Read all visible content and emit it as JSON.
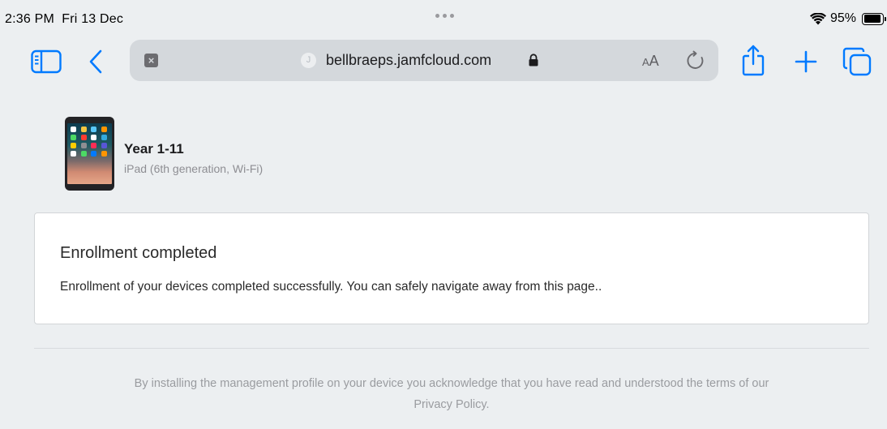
{
  "status_bar": {
    "time": "2:36 PM",
    "date": "Fri 13 Dec",
    "battery": "95%",
    "battery_level": 0.95
  },
  "toolbar": {
    "favicon_letter": "J",
    "url": "bellbraeps.jamfcloud.com",
    "reader_label_small": "A",
    "reader_label_large": "A",
    "accent_color": "#007aff"
  },
  "device": {
    "name": "Year 1-11",
    "model": "iPad (6th generation, Wi-Fi)"
  },
  "notice": {
    "title": "Enrollment completed",
    "message": "Enrollment of your devices completed successfully. You can safely navigate away from this page.."
  },
  "footer": {
    "text": "By installing the management profile on your device you acknowledge that you have read and understood the terms of our",
    "link": "Privacy Policy."
  }
}
